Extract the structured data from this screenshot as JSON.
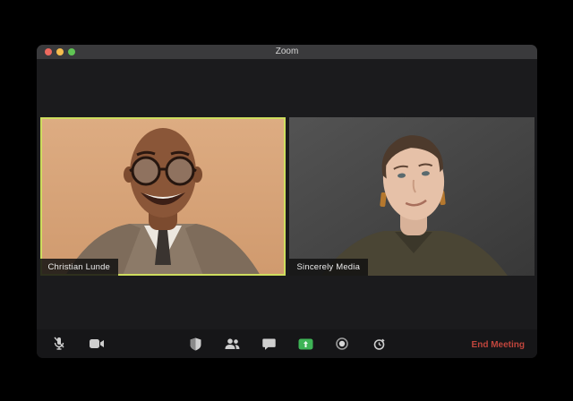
{
  "window": {
    "title": "Zoom"
  },
  "participants": [
    {
      "name": "Christian Lunde",
      "active_speaker": true
    },
    {
      "name": "Sincerely Media",
      "active_speaker": false
    }
  ],
  "toolbar": {
    "icons": [
      "microphone-muted",
      "video-camera",
      "security-shield",
      "participants",
      "chat",
      "share-screen",
      "record",
      "reactions"
    ],
    "end_meeting_label": "End Meeting"
  },
  "colors": {
    "active_speaker_border": "#cedd5e",
    "share_screen_green": "#3eb456",
    "end_meeting_red": "#c0453c",
    "titlebar": "#3a3a3c",
    "window_background": "#1b1b1d"
  }
}
